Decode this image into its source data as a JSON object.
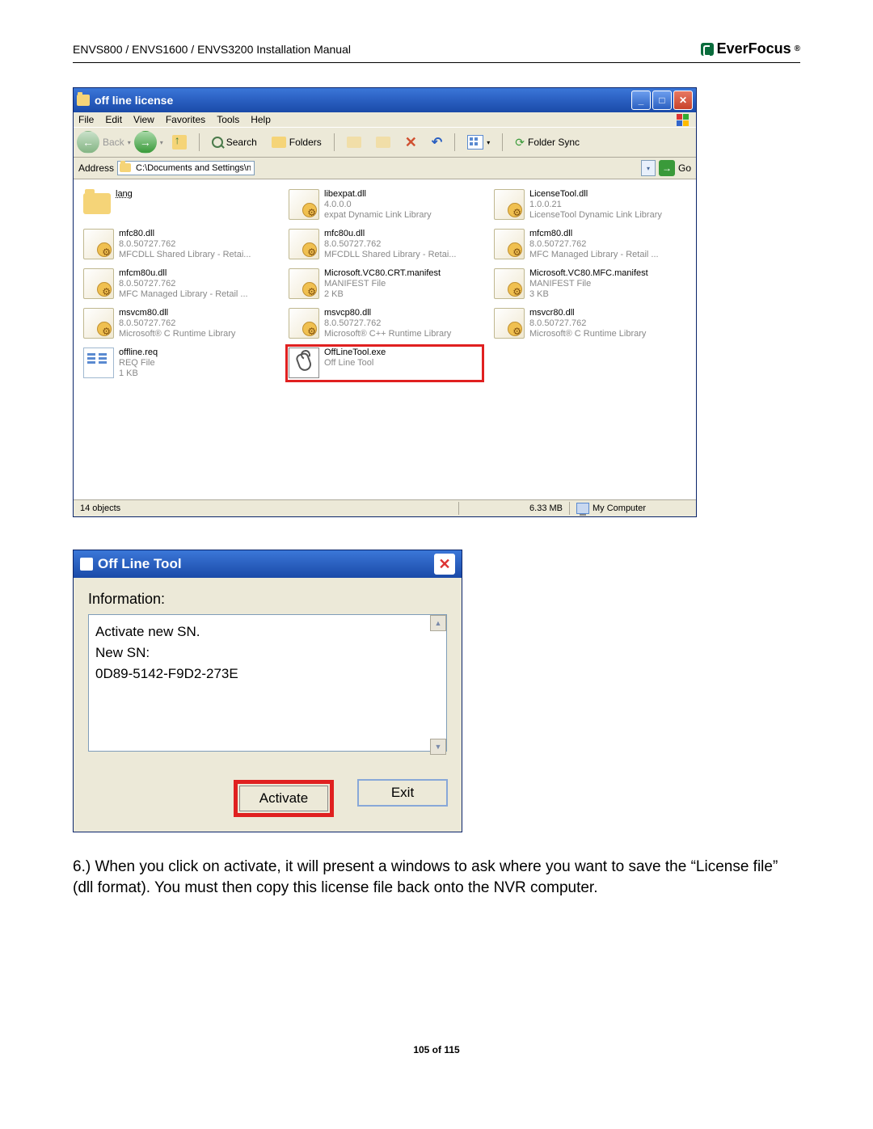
{
  "header": {
    "doc_title": "ENVS800 / ENVS1600 / ENVS3200 Installation Manual",
    "brand": "EverFocus"
  },
  "explorer": {
    "title": "off line license",
    "menus": [
      "File",
      "Edit",
      "View",
      "Favorites",
      "Tools",
      "Help"
    ],
    "toolbar": {
      "back": "Back",
      "search": "Search",
      "folders": "Folders",
      "folder_sync": "Folder Sync"
    },
    "address_label": "Address",
    "address_value": "C:\\Documents and Settings\\nuuo\\Desktop\\off line license",
    "go_label": "Go",
    "files": [
      {
        "icon": "folder",
        "name": "lang",
        "sub1": "",
        "sub2": ""
      },
      {
        "icon": "dll",
        "name": "libexpat.dll",
        "sub1": "4.0.0.0",
        "sub2": "expat Dynamic Link Library"
      },
      {
        "icon": "dll",
        "name": "LicenseTool.dll",
        "sub1": "1.0.0.21",
        "sub2": "LicenseTool Dynamic Link Library"
      },
      {
        "icon": "dll",
        "name": "mfc80.dll",
        "sub1": "8.0.50727.762",
        "sub2": "MFCDLL Shared Library - Retai..."
      },
      {
        "icon": "dll",
        "name": "mfc80u.dll",
        "sub1": "8.0.50727.762",
        "sub2": "MFCDLL Shared Library - Retai..."
      },
      {
        "icon": "dll",
        "name": "mfcm80.dll",
        "sub1": "8.0.50727.762",
        "sub2": "MFC Managed Library - Retail ..."
      },
      {
        "icon": "dll",
        "name": "mfcm80u.dll",
        "sub1": "8.0.50727.762",
        "sub2": "MFC Managed Library - Retail ..."
      },
      {
        "icon": "dll",
        "name": "Microsoft.VC80.CRT.manifest",
        "sub1": "MANIFEST File",
        "sub2": "2 KB"
      },
      {
        "icon": "dll",
        "name": "Microsoft.VC80.MFC.manifest",
        "sub1": "MANIFEST File",
        "sub2": "3 KB"
      },
      {
        "icon": "dll",
        "name": "msvcm80.dll",
        "sub1": "8.0.50727.762",
        "sub2": "Microsoft® C Runtime Library"
      },
      {
        "icon": "dll",
        "name": "msvcp80.dll",
        "sub1": "8.0.50727.762",
        "sub2": "Microsoft® C++ Runtime Library"
      },
      {
        "icon": "dll",
        "name": "msvcr80.dll",
        "sub1": "8.0.50727.762",
        "sub2": "Microsoft® C Runtime Library"
      },
      {
        "icon": "req",
        "name": "offline.req",
        "sub1": "REQ File",
        "sub2": "1 KB"
      },
      {
        "icon": "exe",
        "name": "OffLineTool.exe",
        "sub1": "Off Line Tool",
        "sub2": "",
        "highlight": true
      }
    ],
    "status": {
      "objects": "14 objects",
      "size": "6.33 MB",
      "location": "My Computer"
    }
  },
  "dialog": {
    "title": "Off Line Tool",
    "info_label": "Information:",
    "info_text": "Activate new SN.\nNew SN:\n0D89-5142-F9D2-273E",
    "activate": "Activate",
    "exit": "Exit"
  },
  "body_paragraph": "6.)  When you click on activate, it will present a windows to ask where you want to save the “License file” (dll format). You must then copy this license file back onto the NVR computer.",
  "footer": "105 of 115"
}
